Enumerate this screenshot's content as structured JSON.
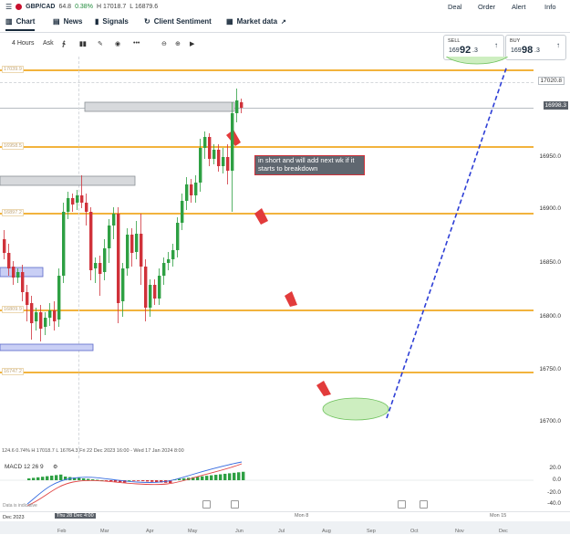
{
  "header": {
    "symbol": "GBP/CAD",
    "rsi": "64.8",
    "change": "0.38%",
    "high": "H 17018.7",
    "low": "L 16879.6",
    "nav": [
      "Deal",
      "Order",
      "Alert",
      "Info"
    ]
  },
  "tabs": [
    {
      "label": "Chart",
      "icon": "chart-icon"
    },
    {
      "label": "News",
      "icon": "news-icon"
    },
    {
      "label": "Signals",
      "icon": "signals-icon"
    },
    {
      "label": "Client Sentiment",
      "icon": "sentiment-icon"
    },
    {
      "label": "Market data",
      "icon": "market-data-icon"
    }
  ],
  "toolbar": {
    "interval": "4 Hours",
    "price_side": "Ask"
  },
  "quote": {
    "sell_label": "SELL",
    "sell_prefix": "169",
    "sell_big": "92",
    "sell_small": ".3",
    "buy_label": "BUY",
    "buy_prefix": "169",
    "buy_big": "98",
    "buy_small": ".3"
  },
  "axis_labels": [
    "17020.8",
    "16998.3",
    "16950.0",
    "16900.0",
    "16850.0",
    "16800.0",
    "16750.0",
    "16700.0"
  ],
  "levels": [
    "17039.9",
    "16958.5",
    "16897.2",
    "16809.9",
    "16747.2"
  ],
  "annotation_text": "in short and will add next wk if it starts to breakdown",
  "footer": {
    "info": "124.6   0.74%   H 17018.7   L 16764.3   Fri 22 Dec 2023 16:00 - Wed 17 Jan 2024 8:00"
  },
  "macd": {
    "label": "MACD 12 26 9",
    "axis": [
      "20.0",
      "0.0",
      "-20.0",
      "-40.0"
    ]
  },
  "data_note": "Data is indicative",
  "time_axis": {
    "top": [
      "Thu 28 Dec 4:00",
      "Mon 8",
      "Mon 15"
    ],
    "bottom": [
      "Dec 2023",
      "Feb",
      "Mar",
      "Apr",
      "May",
      "Jun",
      "Jul",
      "Aug",
      "Sep",
      "Oct",
      "Nov",
      "Dec"
    ]
  },
  "colors": {
    "up": "#2ea043",
    "down": "#d0323a",
    "level": "#f2b33d"
  }
}
